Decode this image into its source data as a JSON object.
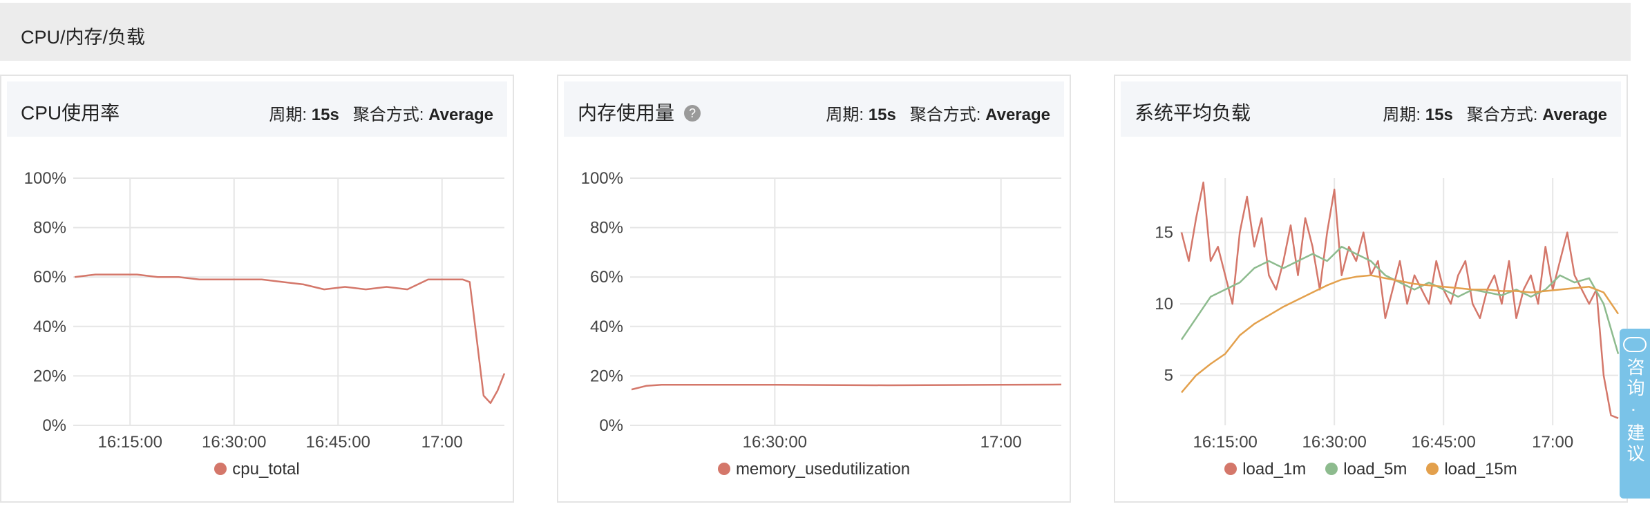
{
  "section": {
    "title": "CPU/内存/负载"
  },
  "consult": {
    "label": "咨询 · 建议"
  },
  "panels": [
    {
      "title": "CPU使用率",
      "period_label": "周期:",
      "period_value": "15s",
      "agg_label": "聚合方式:",
      "agg_value": "Average",
      "legend": [
        {
          "name": "cpu_total",
          "color": "#d4776a"
        }
      ]
    },
    {
      "title": "内存使用量",
      "help_icon": "?",
      "period_label": "周期:",
      "period_value": "15s",
      "agg_label": "聚合方式:",
      "agg_value": "Average",
      "legend": [
        {
          "name": "memory_usedutilization",
          "color": "#d4776a"
        }
      ]
    },
    {
      "title": "系统平均负载",
      "period_label": "周期:",
      "period_value": "15s",
      "agg_label": "聚合方式:",
      "agg_value": "Average",
      "legend": [
        {
          "name": "load_1m",
          "color": "#d4776a"
        },
        {
          "name": "load_5m",
          "color": "#8dbb8e"
        },
        {
          "name": "load_15m",
          "color": "#e3a04c"
        }
      ]
    }
  ],
  "chart_data": [
    {
      "type": "line",
      "x_range": [
        "16:07",
        "17:09"
      ],
      "xticks": [
        "16:15:00",
        "16:30:00",
        "16:45:00",
        "17:00"
      ],
      "yticks": [
        "0%",
        "20%",
        "40%",
        "60%",
        "80%",
        "100%"
      ],
      "ylim": [
        0,
        100
      ],
      "grid": true,
      "series": [
        {
          "name": "cpu_total",
          "color": "#d4776a",
          "x": [
            "16:07",
            "16:10",
            "16:13",
            "16:16",
            "16:19",
            "16:22",
            "16:25",
            "16:28",
            "16:31",
            "16:34",
            "16:37",
            "16:40",
            "16:43",
            "16:46",
            "16:49",
            "16:52",
            "16:55",
            "16:58",
            "17:01",
            "17:03",
            "17:04",
            "17:05",
            "17:06",
            "17:07",
            "17:08",
            "17:09"
          ],
          "y": [
            60,
            61,
            61,
            61,
            60,
            60,
            59,
            59,
            59,
            59,
            58,
            57,
            55,
            56,
            55,
            56,
            55,
            59,
            59,
            59,
            58,
            35,
            12,
            9,
            14,
            21
          ]
        }
      ]
    },
    {
      "type": "line",
      "x_range": [
        "16:11",
        "17:08"
      ],
      "xticks": [
        "16:30:00",
        "17:00"
      ],
      "yticks": [
        "0%",
        "20%",
        "40%",
        "60%",
        "80%",
        "100%"
      ],
      "ylim": [
        0,
        100
      ],
      "grid": true,
      "series": [
        {
          "name": "memory_usedutilization",
          "color": "#d4776a",
          "x": [
            "16:11",
            "16:13",
            "16:15",
            "16:30",
            "16:45",
            "17:00",
            "17:08"
          ],
          "y": [
            14.5,
            16,
            16.4,
            16.4,
            16.2,
            16.4,
            16.5
          ]
        }
      ]
    },
    {
      "type": "line",
      "x_range": [
        "16:09",
        "17:09"
      ],
      "xticks": [
        "16:15:00",
        "16:30:00",
        "16:45:00",
        "17:00"
      ],
      "yticks": [
        "5",
        "10",
        "15"
      ],
      "ylim": [
        1.5,
        18.8
      ],
      "grid": true,
      "series": [
        {
          "name": "load_1m",
          "color": "#d4776a",
          "x": [
            "16:09",
            "16:10",
            "16:11",
            "16:12",
            "16:13",
            "16:14",
            "16:15",
            "16:16",
            "16:17",
            "16:18",
            "16:19",
            "16:20",
            "16:21",
            "16:22",
            "16:23",
            "16:24",
            "16:25",
            "16:26",
            "16:27",
            "16:28",
            "16:29",
            "16:30",
            "16:31",
            "16:32",
            "16:33",
            "16:34",
            "16:35",
            "16:36",
            "16:37",
            "16:38",
            "16:39",
            "16:40",
            "16:41",
            "16:42",
            "16:43",
            "16:44",
            "16:45",
            "16:46",
            "16:47",
            "16:48",
            "16:49",
            "16:50",
            "16:51",
            "16:52",
            "16:53",
            "16:54",
            "16:55",
            "16:56",
            "16:57",
            "16:58",
            "16:59",
            "17:00",
            "17:01",
            "17:02",
            "17:03",
            "17:04",
            "17:05",
            "17:06",
            "17:07",
            "17:08",
            "17:09"
          ],
          "y": [
            15,
            13,
            16,
            18.5,
            13,
            14,
            12,
            10,
            15,
            17.5,
            14,
            16,
            12,
            11,
            13,
            15.5,
            12,
            16,
            14,
            11,
            15,
            18,
            12,
            14,
            13,
            15,
            12,
            13,
            9,
            11,
            13,
            10,
            12,
            11,
            10,
            13,
            11,
            10,
            12,
            13,
            10,
            9,
            11,
            12,
            10,
            13,
            9,
            11,
            12,
            10,
            14,
            11,
            13,
            15,
            12,
            11,
            10,
            11,
            5,
            2.2,
            2
          ]
        },
        {
          "name": "load_5m",
          "color": "#8dbb8e",
          "x": [
            "16:09",
            "16:11",
            "16:13",
            "16:15",
            "16:17",
            "16:19",
            "16:21",
            "16:23",
            "16:25",
            "16:27",
            "16:29",
            "16:31",
            "16:33",
            "16:35",
            "16:37",
            "16:39",
            "16:41",
            "16:43",
            "16:45",
            "16:47",
            "16:49",
            "16:51",
            "16:53",
            "16:55",
            "16:57",
            "16:59",
            "17:01",
            "17:03",
            "17:05",
            "17:07",
            "17:09"
          ],
          "y": [
            7.5,
            9,
            10.5,
            11,
            11.5,
            12.5,
            13,
            12.5,
            13,
            13.5,
            13,
            14,
            13.5,
            13,
            12,
            11.5,
            11,
            11.5,
            11,
            10.5,
            11,
            10.8,
            10.6,
            11,
            10.5,
            11,
            12,
            11.5,
            11.8,
            10,
            6.5
          ]
        },
        {
          "name": "load_15m",
          "color": "#e3a04c",
          "x": [
            "16:09",
            "16:11",
            "16:13",
            "16:15",
            "16:17",
            "16:19",
            "16:21",
            "16:23",
            "16:25",
            "16:27",
            "16:29",
            "16:31",
            "16:33",
            "16:35",
            "16:37",
            "16:39",
            "16:41",
            "16:43",
            "16:45",
            "16:47",
            "16:49",
            "16:51",
            "16:53",
            "16:55",
            "16:57",
            "16:59",
            "17:01",
            "17:03",
            "17:05",
            "17:07",
            "17:09"
          ],
          "y": [
            3.8,
            5,
            5.8,
            6.5,
            7.8,
            8.6,
            9.2,
            9.8,
            10.3,
            10.8,
            11.3,
            11.7,
            11.9,
            12,
            11.8,
            11.6,
            11.4,
            11.3,
            11.2,
            11.1,
            11,
            11,
            10.9,
            10.9,
            10.8,
            10.9,
            11,
            11.1,
            11.2,
            10.8,
            9.3
          ]
        }
      ]
    }
  ]
}
